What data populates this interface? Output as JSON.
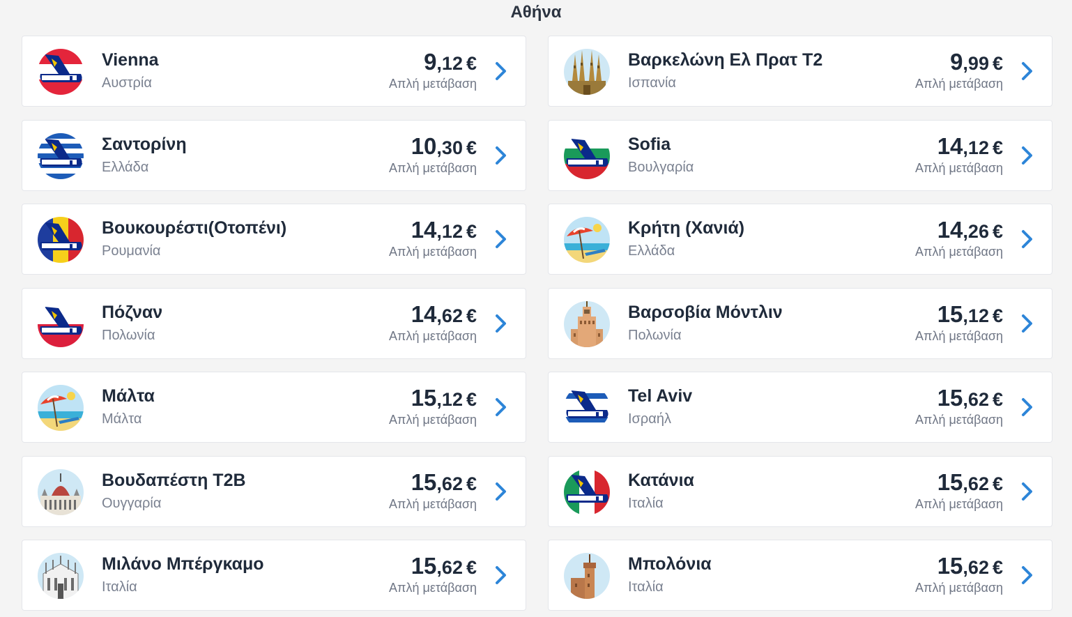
{
  "page": {
    "title": "Αθήνα"
  },
  "colors": {
    "accent": "#2d85d8",
    "text": "#1f2a3a",
    "muted": "#7a8190"
  },
  "destinations": [
    {
      "city": "Vienna",
      "country": "Αυστρία",
      "price_int": "9",
      "price_dec": ",12",
      "currency": "€",
      "price_type": "Απλή μετάβαση",
      "icon": "ryanair-austria-icon"
    },
    {
      "city": "Βαρκελώνη Ελ Πρατ T2",
      "country": "Ισπανία",
      "price_int": "9",
      "price_dec": ",99",
      "currency": "€",
      "price_type": "Απλή μετάβαση",
      "icon": "sagrada-familia-icon"
    },
    {
      "city": "Σαντορίνη",
      "country": "Ελλάδα",
      "price_int": "10",
      "price_dec": ",30",
      "currency": "€",
      "price_type": "Απλή μετάβαση",
      "icon": "ryanair-greece-icon"
    },
    {
      "city": "Sofia",
      "country": "Βουλγαρία",
      "price_int": "14",
      "price_dec": ",12",
      "currency": "€",
      "price_type": "Απλή μετάβαση",
      "icon": "ryanair-bulgaria-icon"
    },
    {
      "city": "Βουκουρέστι(Οτοπένι)",
      "country": "Ρουμανία",
      "price_int": "14",
      "price_dec": ",12",
      "currency": "€",
      "price_type": "Απλή μετάβαση",
      "icon": "ryanair-romania-icon"
    },
    {
      "city": "Κρήτη (Χανιά)",
      "country": "Ελλάδα",
      "price_int": "14",
      "price_dec": ",26",
      "currency": "€",
      "price_type": "Απλή μετάβαση",
      "icon": "beach-umbrella-icon"
    },
    {
      "city": "Πόζναν",
      "country": "Πολωνία",
      "price_int": "14",
      "price_dec": ",62",
      "currency": "€",
      "price_type": "Απλή μετάβαση",
      "icon": "ryanair-poland-icon"
    },
    {
      "city": "Βαρσοβία Μόντλιν",
      "country": "Πολωνία",
      "price_int": "15",
      "price_dec": ",12",
      "currency": "€",
      "price_type": "Απλή μετάβαση",
      "icon": "palace-of-culture-icon"
    },
    {
      "city": "Μάλτα",
      "country": "Μάλτα",
      "price_int": "15",
      "price_dec": ",12",
      "currency": "€",
      "price_type": "Απλή μετάβαση",
      "icon": "beach-umbrella-icon"
    },
    {
      "city": "Tel Aviv",
      "country": "Ισραήλ",
      "price_int": "15",
      "price_dec": ",62",
      "currency": "€",
      "price_type": "Απλή μετάβαση",
      "icon": "ryanair-israel-icon"
    },
    {
      "city": "Βουδαπέστη T2B",
      "country": "Ουγγαρία",
      "price_int": "15",
      "price_dec": ",62",
      "currency": "€",
      "price_type": "Απλή μετάβαση",
      "icon": "parliament-building-icon"
    },
    {
      "city": "Κατάνια",
      "country": "Ιταλία",
      "price_int": "15",
      "price_dec": ",62",
      "currency": "€",
      "price_type": "Απλή μετάβαση",
      "icon": "ryanair-italy-icon"
    },
    {
      "city": "Μιλάνο Μπέργκαμο",
      "country": "Ιταλία",
      "price_int": "15",
      "price_dec": ",62",
      "currency": "€",
      "price_type": "Απλή μετάβαση",
      "icon": "milan-cathedral-icon"
    },
    {
      "city": "Μπολόνια",
      "country": "Ιταλία",
      "price_int": "15",
      "price_dec": ",62",
      "currency": "€",
      "price_type": "Απλή μετάβαση",
      "icon": "bologna-tower-icon"
    }
  ]
}
